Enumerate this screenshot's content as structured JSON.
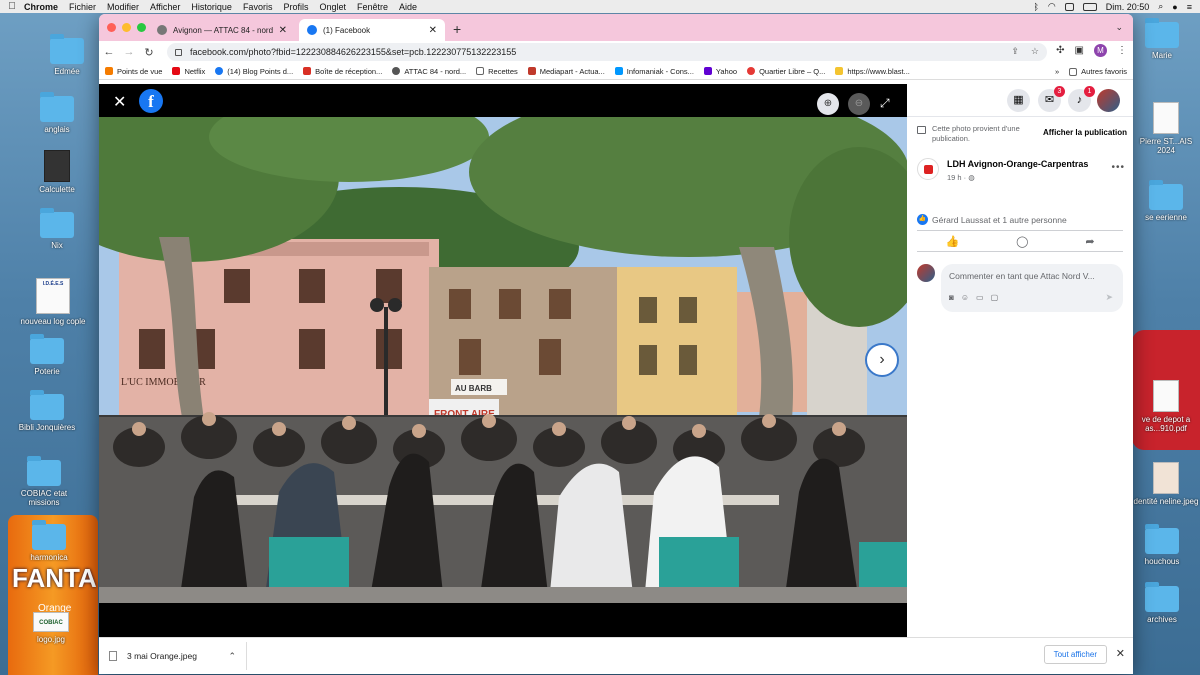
{
  "mac_menu": {
    "apple": "",
    "items": [
      "Chrome",
      "Fichier",
      "Modifier",
      "Afficher",
      "Historique",
      "Favoris",
      "Profils",
      "Onglet",
      "Fenêtre",
      "Aide"
    ],
    "clock": "Dim. 20:50"
  },
  "desktop": {
    "icons": [
      {
        "label": "Edmée"
      },
      {
        "label": "anglais"
      },
      {
        "label": "Calculette"
      },
      {
        "label": "Nix"
      },
      {
        "label": "nouveau log cople"
      },
      {
        "label": "Poterie"
      },
      {
        "label": "Bibli Jonquières"
      },
      {
        "label": "COBIAC etat missions"
      },
      {
        "label": "harmonica"
      },
      {
        "label": "logo.jpg"
      }
    ],
    "right_icons": [
      {
        "label": "Marie"
      },
      {
        "label": "Pierre ST...AIS 2024"
      },
      {
        "label": "se eerienne"
      },
      {
        "label": "ve de depot a as...910.pdf"
      },
      {
        "label": "dentité neline.jpeg"
      },
      {
        "label": "houchous"
      },
      {
        "label": "archives"
      }
    ],
    "logo_tiles": {
      "ideas": "I.D.É.E.S",
      "cobiac": "COBIAC",
      "fanta": "FANTA",
      "orange": "Orange"
    }
  },
  "tabs": [
    {
      "title": "Avignon — ATTAC 84 - nord V...",
      "active": false
    },
    {
      "title": "(1) Facebook",
      "active": true
    }
  ],
  "address_bar": {
    "url": "facebook.com/photo?fbid=122230884626223155&set=pcb.122230775132223155"
  },
  "profile_initial": "M",
  "bookmarks": [
    "Points de vue",
    "Netflix",
    "(14) Blog Points d...",
    "Boîte de réception...",
    "ATTAC 84 - nord...",
    "Recettes",
    "Mediapart - Actua...",
    "Infomaniak - Cons...",
    "Yahoo",
    "Quartier Libre – Q...",
    "https://www.blast..."
  ],
  "bookmarks_more": "»",
  "bookmarks_folder": "Autres favoris",
  "viewer": {
    "close": "✕",
    "logo": "f",
    "zoom_in": "⊕",
    "zoom_out": "⊖",
    "fullscreen": "⤢",
    "next": "›"
  },
  "photo": {
    "shop_sign": "L'UC IMMOBILIER",
    "cafe_sign": "AU BARB",
    "banner": "FRONT AIRE"
  },
  "sidebar": {
    "notification_badge_messenger": "3",
    "notification_badge_bell": "1",
    "provenance_text": "Cette photo provient d'une publication.",
    "provenance_link": "Afficher la publication",
    "author": "LDH Avignon-Orange-Carpentras",
    "time": "19 h ·",
    "reactions": "Gérard Laussat et 1 autre personne",
    "comment_placeholder": "Commenter en tant que Attac Nord V..."
  },
  "downloads": {
    "file": "3 mai Orange.jpeg",
    "show_all": "Tout afficher"
  }
}
